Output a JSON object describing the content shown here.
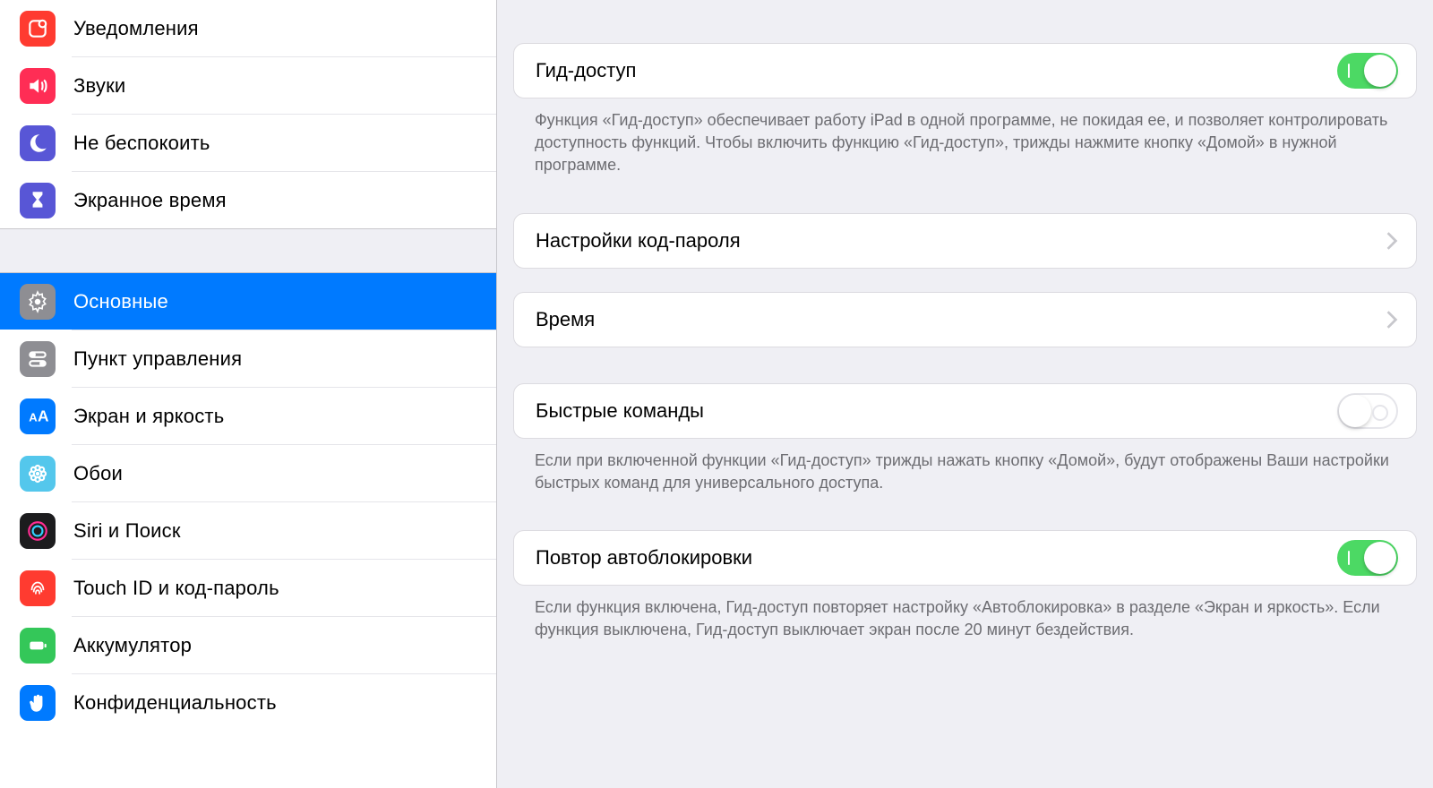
{
  "sidebar": {
    "group1": [
      {
        "id": "notifications",
        "label": "Уведомления",
        "color": "#ff3b30",
        "icon": "notifications"
      },
      {
        "id": "sounds",
        "label": "Звуки",
        "color": "#ff2d55",
        "icon": "sounds"
      },
      {
        "id": "dnd",
        "label": "Не беспокоить",
        "color": "#5856d6",
        "icon": "moon"
      },
      {
        "id": "screentime",
        "label": "Экранное время",
        "color": "#5856d6",
        "icon": "hourglass"
      }
    ],
    "group2": [
      {
        "id": "general",
        "label": "Основные",
        "color": "#8e8e93",
        "icon": "gear",
        "selected": true
      },
      {
        "id": "controlcenter",
        "label": "Пункт управления",
        "color": "#8e8e93",
        "icon": "switches"
      },
      {
        "id": "display",
        "label": "Экран и яркость",
        "color": "#007aff",
        "icon": "aa"
      },
      {
        "id": "wallpaper",
        "label": "Обои",
        "color": "#54c7ec",
        "icon": "flower"
      },
      {
        "id": "siri",
        "label": "Siri и Поиск",
        "color": "#1c1c1e",
        "icon": "siri"
      },
      {
        "id": "touchid",
        "label": "Touch ID и код-пароль",
        "color": "#ff3b30",
        "icon": "fingerprint"
      },
      {
        "id": "battery",
        "label": "Аккумулятор",
        "color": "#34c759",
        "icon": "battery"
      },
      {
        "id": "privacy",
        "label": "Конфиденциальность",
        "color": "#007aff",
        "icon": "hand"
      }
    ]
  },
  "content": {
    "guided_access": {
      "title": "Гид-доступ",
      "on": true,
      "footer": "Функция «Гид-доступ» обеспечивает работу iPad в одной программе, не покидая ее, и позволяет контролировать доступность функций. Чтобы включить функцию «Гид-доступ», трижды нажмите кнопку «Домой» в нужной программе."
    },
    "passcode": {
      "title": "Настройки код-пароля"
    },
    "time": {
      "title": "Время"
    },
    "shortcuts": {
      "title": "Быстрые команды",
      "on": false,
      "footer": "Если при включенной функции «Гид-доступ» трижды нажать кнопку «Домой», будут отображены Ваши настройки быстрых команд для универсального доступа."
    },
    "autolock": {
      "title": "Повтор автоблокировки",
      "on": true,
      "footer": "Если функция включена, Гид-доступ повторяет настройку «Автоблокировка» в разделе «Экран и яркость». Если функция выключена, Гид-доступ выключает экран после 20 минут бездействия."
    }
  }
}
